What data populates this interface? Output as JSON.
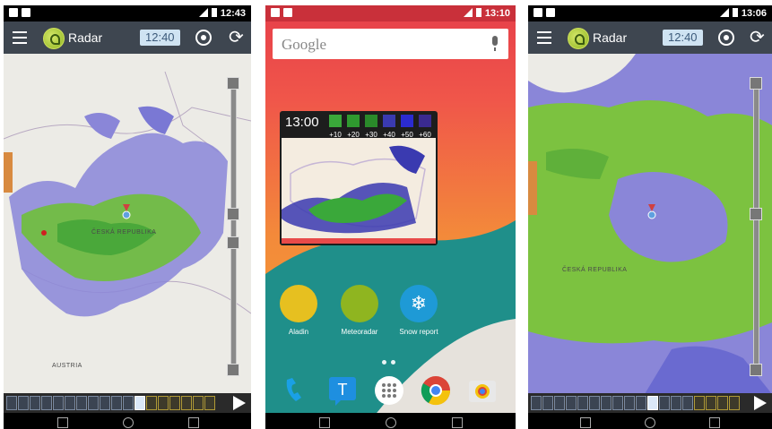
{
  "screens": [
    {
      "status_time": "12:43",
      "app_title": "Radar",
      "radar_time": "12:40",
      "map_labels": [
        "ČESKÁ REPUBLIKA",
        "AUSTRIA"
      ]
    },
    {
      "status_time": "13:10",
      "search_placeholder": "Google",
      "widget": {
        "time": "13:00",
        "legend": [
          {
            "label": "+10",
            "color": "#3aa83a"
          },
          {
            "label": "+20",
            "color": "#2f9a2f"
          },
          {
            "label": "+30",
            "color": "#2a8a2a"
          },
          {
            "label": "+40",
            "color": "#3a3ab0"
          },
          {
            "label": "+50",
            "color": "#2b2bd0"
          },
          {
            "label": "+60",
            "color": "#3a2a90"
          }
        ]
      },
      "apps": [
        {
          "label": "Aladin",
          "icon": "aladin-lamp-icon",
          "color": "#e6c020"
        },
        {
          "label": "Meteoradar",
          "icon": "meteoradar-dish-icon",
          "color": "#8fb520"
        },
        {
          "label": "Snow report",
          "icon": "snowflake-icon",
          "color": "#1e9ad6"
        }
      ],
      "dock": [
        "phone-icon",
        "messenger-icon",
        "app-drawer-icon",
        "chrome-icon",
        "camera-icon"
      ]
    },
    {
      "status_time": "13:06",
      "app_title": "Radar",
      "radar_time": "12:40",
      "map_labels": [
        "ČESKÁ REPUBLIKA"
      ]
    }
  ]
}
